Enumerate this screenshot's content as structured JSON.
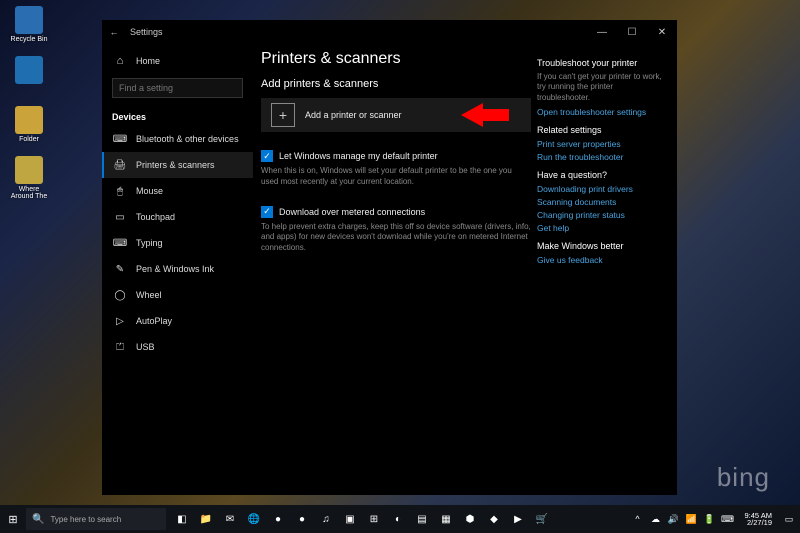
{
  "desktop": {
    "icons": [
      {
        "label": "Recycle Bin",
        "color": "#2a6db0"
      },
      {
        "label": "",
        "color": "#1f6fb0"
      },
      {
        "label": "Folder",
        "color": "#caa33a"
      },
      {
        "label": "Where Around The",
        "color": "#bfa640"
      }
    ],
    "bing": "bing"
  },
  "window": {
    "title": "Settings",
    "controls": {
      "min": "—",
      "max": "☐",
      "close": "✕"
    },
    "sidebar": {
      "home": "Home",
      "search_placeholder": "Find a setting",
      "section": "Devices",
      "items": [
        {
          "icon": "⌨",
          "label": "Bluetooth & other devices"
        },
        {
          "icon": "🖨",
          "label": "Printers & scanners",
          "selected": true
        },
        {
          "icon": "🖱",
          "label": "Mouse"
        },
        {
          "icon": "▭",
          "label": "Touchpad"
        },
        {
          "icon": "⌨",
          "label": "Typing"
        },
        {
          "icon": "✎",
          "label": "Pen & Windows Ink"
        },
        {
          "icon": "◯",
          "label": "Wheel"
        },
        {
          "icon": "▷",
          "label": "AutoPlay"
        },
        {
          "icon": "⏍",
          "label": "USB"
        }
      ]
    },
    "content": {
      "h1": "Printers & scanners",
      "h2": "Add printers & scanners",
      "add_button": "Add a printer or scanner",
      "opt1": {
        "label": "Let Windows manage my default printer",
        "desc": "When this is on, Windows will set your default printer to be the one you used most recently at your current location."
      },
      "opt2": {
        "label": "Download over metered connections",
        "desc": "To help prevent extra charges, keep this off so device software (drivers, info, and apps) for new devices won't download while you're on metered Internet connections."
      }
    },
    "rightcol": {
      "sec1": {
        "title": "Troubleshoot your printer",
        "desc": "If you can't get your printer to work, try running the printer troubleshooter.",
        "link": "Open troubleshooter settings"
      },
      "sec2": {
        "title": "Related settings",
        "links": [
          "Print server properties",
          "Run the troubleshooter"
        ]
      },
      "sec3": {
        "title": "Have a question?",
        "links": [
          "Downloading print drivers",
          "Scanning documents",
          "Changing printer status",
          "Get help"
        ]
      },
      "sec4": {
        "title": "Make Windows better",
        "link": "Give us feedback"
      }
    }
  },
  "taskbar": {
    "search": "Type here to search",
    "time": "9:45 AM",
    "date": "2/27/19",
    "icons": [
      "◧",
      "📁",
      "✉",
      "🌐",
      "●",
      "●",
      "♫",
      "▣",
      "⊞",
      "◐",
      "▤",
      "▦",
      "⬢",
      "◆",
      "▶",
      "🛒"
    ],
    "tray": [
      "^",
      "☁",
      "🔊",
      "📶",
      "🔋",
      "⌨"
    ]
  }
}
